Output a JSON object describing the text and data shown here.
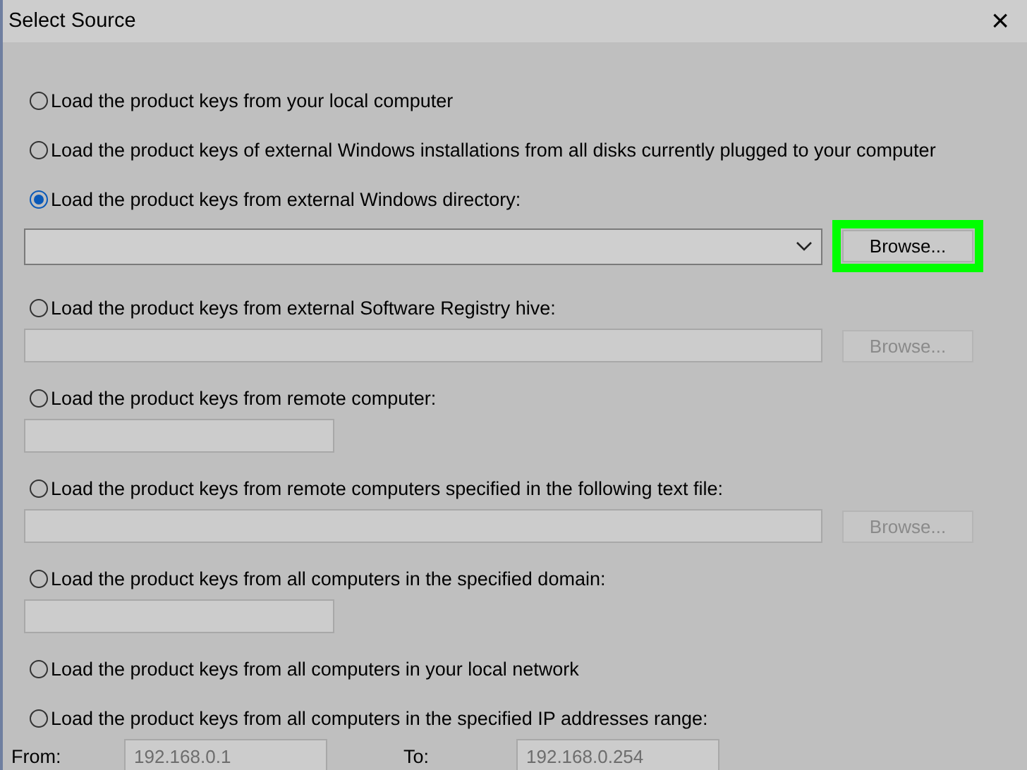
{
  "window": {
    "title": "Select Source",
    "close": "×"
  },
  "options": [
    {
      "label": "Load the product keys from your local computer",
      "selected": false
    },
    {
      "label": "Load the product keys of external Windows installations from all disks currently plugged to your computer",
      "selected": false
    },
    {
      "label": "Load the product keys from external Windows directory:",
      "selected": true,
      "field": {
        "kind": "combo",
        "disabled": false,
        "browse": {
          "label": "Browse...",
          "disabled": false,
          "highlighted": true
        }
      }
    },
    {
      "label": "Load the product keys from external Software Registry hive:",
      "selected": false,
      "field": {
        "kind": "path",
        "disabled": true,
        "browse": {
          "label": "Browse...",
          "disabled": true,
          "highlighted": false
        }
      }
    },
    {
      "label": "Load the product keys from remote computer:",
      "selected": false,
      "field": {
        "kind": "short",
        "disabled": true
      }
    },
    {
      "label": "Load the product keys from remote computers specified in the following text file:",
      "selected": false,
      "field": {
        "kind": "path",
        "disabled": true,
        "browse": {
          "label": "Browse...",
          "disabled": true,
          "highlighted": false
        }
      }
    },
    {
      "label": "Load the product keys from all computers in the specified domain:",
      "selected": false,
      "field": {
        "kind": "short",
        "disabled": true
      }
    },
    {
      "label": "Load the product keys from all computers in your local network",
      "selected": false
    },
    {
      "label": "Load the product keys from all computers in the specified IP addresses range:",
      "selected": false,
      "field": {
        "kind": "range",
        "disabled": true,
        "from_label": "From:",
        "from_value": "192.168.0.1",
        "to_label": "To:",
        "to_value": "192.168.0.254"
      }
    }
  ]
}
